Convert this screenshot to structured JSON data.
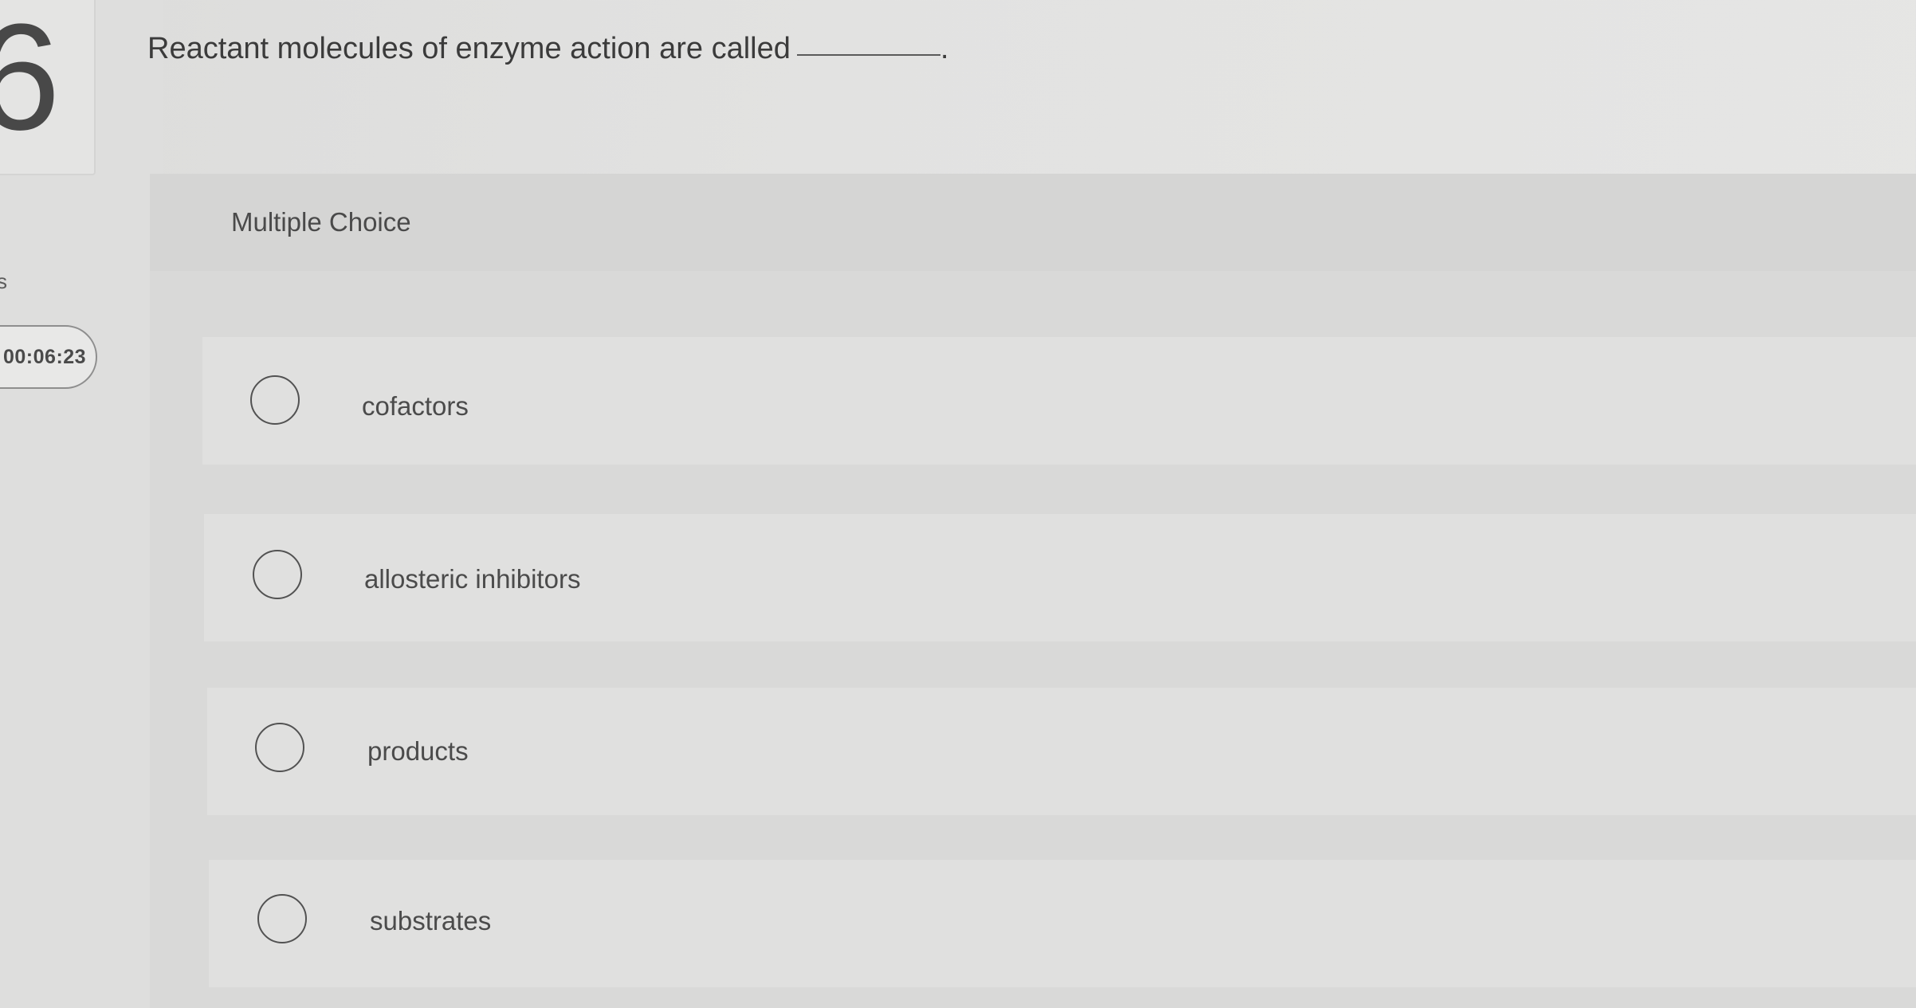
{
  "question": {
    "number": "6",
    "prompt": "Reactant molecules of enzyme action are called",
    "blank_suffix": "."
  },
  "sidebar": {
    "fragment": "s",
    "timer": "00:06:23"
  },
  "panel": {
    "type_label": "Multiple Choice"
  },
  "options": [
    {
      "label": "cofactors",
      "selected": false
    },
    {
      "label": "allosteric inhibitors",
      "selected": false
    },
    {
      "label": "products",
      "selected": false
    },
    {
      "label": "substrates",
      "selected": false
    }
  ]
}
